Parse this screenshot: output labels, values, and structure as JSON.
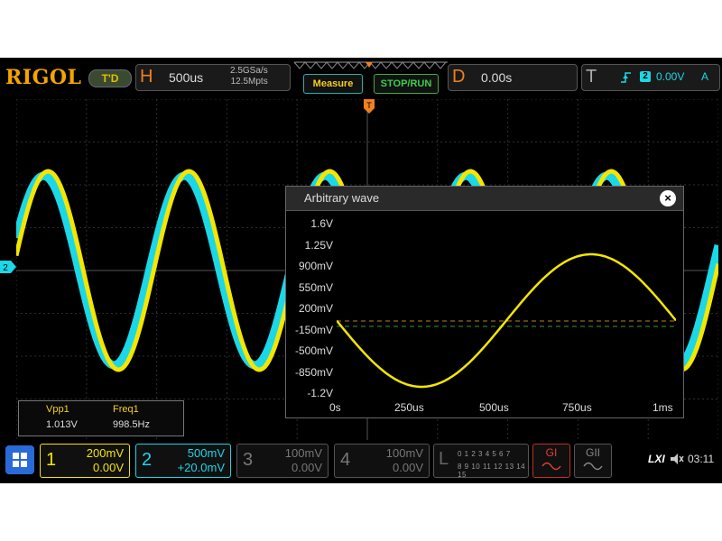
{
  "brand": {
    "logo": "RIGOL",
    "mode_badge": "T'D"
  },
  "horizontal": {
    "letter": "H",
    "timebase": "500us",
    "sample_rate": "2.5GSa/s",
    "mem_depth": "12.5Mpts"
  },
  "buttons": {
    "measure": "Measure",
    "stop_run": "STOP/RUN"
  },
  "delay": {
    "letter": "D",
    "value": "0.00s"
  },
  "trigger": {
    "letter": "T",
    "source": "2",
    "level": "0.00V",
    "mode": "A"
  },
  "screen": {
    "ch2_marker": "2",
    "trigger_marker": "T",
    "colors": {
      "ch1": "#f5e600",
      "ch2": "#1ad8e8",
      "background": "#000000",
      "grid": "#3a3a3a"
    }
  },
  "arb_dialog": {
    "title": "Arbitrary wave",
    "close": "×",
    "y_labels": [
      "1.6V",
      "1.25V",
      "900mV",
      "550mV",
      "200mV",
      "-150mV",
      "-500mV",
      "-850mV",
      "-1.2V"
    ],
    "x_labels": [
      "0s",
      "250us",
      "500us",
      "750us",
      "1ms"
    ]
  },
  "measurements": {
    "headers": [
      "Vpp1",
      "Freq1"
    ],
    "values": [
      "1.013V",
      "998.5Hz"
    ]
  },
  "channels": [
    {
      "num": "1",
      "scale": "200mV",
      "offset": "0.00V",
      "color": "#f5e600",
      "active": true
    },
    {
      "num": "2",
      "scale": "500mV",
      "offset": "+20.0mV",
      "color": "#1ad8e8",
      "active": true
    },
    {
      "num": "3",
      "scale": "100mV",
      "offset": "0.00V",
      "color": "#777777",
      "active": false
    },
    {
      "num": "4",
      "scale": "100mV",
      "offset": "0.00V",
      "color": "#777777",
      "active": false
    }
  ],
  "digital": {
    "letter": "L",
    "row1": "0 1 2 3 4 5 6 7",
    "row2": "8 9 10 11 12 13 14 15"
  },
  "bus": {
    "g1": "GI",
    "g2": "GII"
  },
  "status": {
    "lxi": "LXI",
    "time": "03:11"
  }
}
